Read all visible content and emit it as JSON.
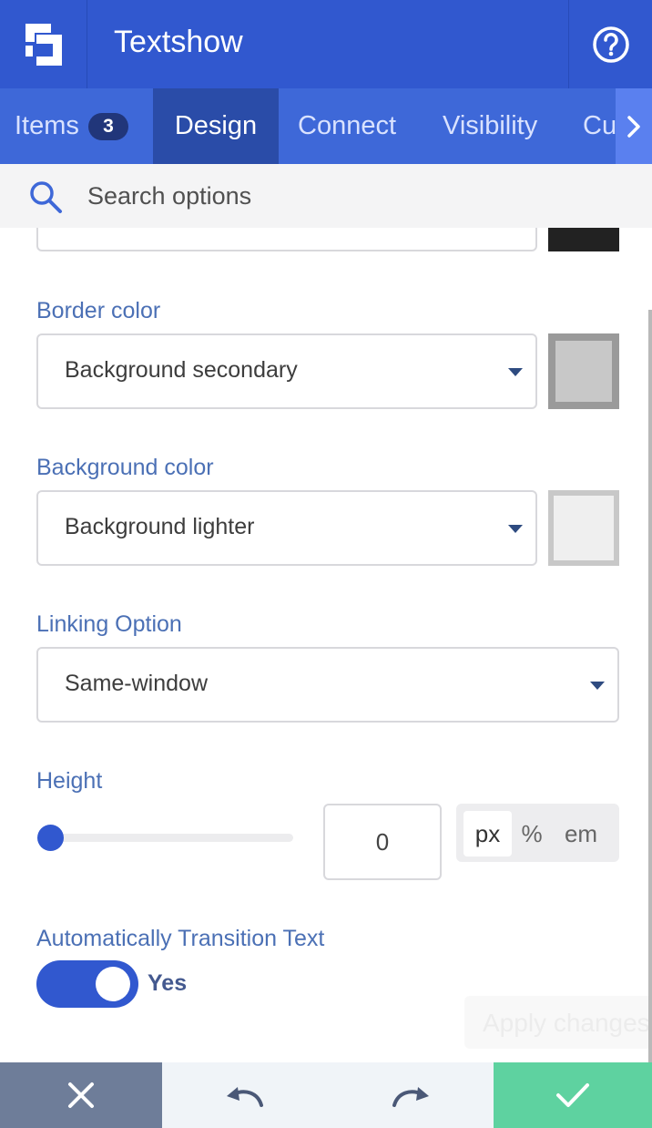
{
  "app": {
    "title": "Textshow"
  },
  "tabs": [
    {
      "label": "Items",
      "badge": "3"
    },
    {
      "label": "Design"
    },
    {
      "label": "Connect"
    },
    {
      "label": "Visibility"
    },
    {
      "label": "Cu"
    }
  ],
  "search": {
    "placeholder": "Search options"
  },
  "fields": {
    "border_color": {
      "label": "Border color",
      "value": "Background secondary",
      "swatch": "#c8c8c8",
      "swatch_border": "#9a9a9a"
    },
    "background_color": {
      "label": "Background color",
      "value": "Background lighter",
      "swatch": "#efefef",
      "swatch_border": "#c8c8c8"
    },
    "linking_option": {
      "label": "Linking Option",
      "value": "Same-window"
    },
    "height": {
      "label": "Height",
      "value": "0",
      "units": [
        "px",
        "%",
        "em"
      ],
      "active_unit": "px",
      "slider_fraction": 0
    },
    "auto_transition": {
      "label": "Automatically Transition Text",
      "state": "Yes"
    }
  },
  "apply_label": "Apply changes",
  "colors": {
    "primary": "#3158cf",
    "tab_bar": "#3e68d8",
    "accept": "#5ed2a0",
    "cancel": "#6e7d99",
    "label": "#4b70b5"
  }
}
